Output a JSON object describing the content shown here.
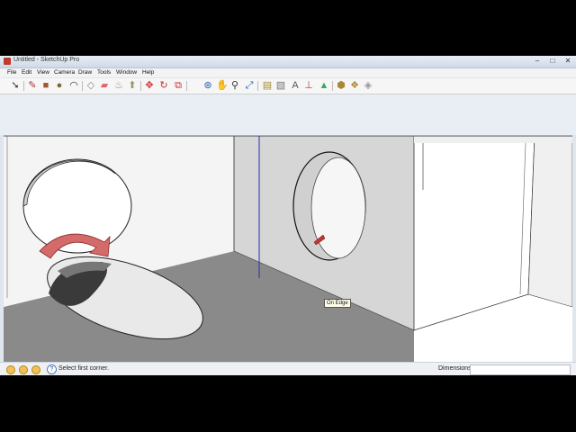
{
  "window": {
    "title": "Untitled - SketchUp Pro"
  },
  "menu": [
    "File",
    "Edit",
    "View",
    "Camera",
    "Draw",
    "Tools",
    "Window",
    "Help"
  ],
  "window_buttons": {
    "minimize": "–",
    "maximize": "□",
    "close": "✕"
  },
  "toolbar_icons": [
    "select-tool-icon",
    "line-tool-icon",
    "rectangle-tool-icon",
    "circle-tool-icon",
    "arc-tool-icon",
    "make-component-icon",
    "eraser-tool-icon",
    "paint-bucket-icon",
    "push-pull-tool-icon",
    "move-tool-icon",
    "rotate-tool-icon",
    "offset-tool-icon",
    "orbit-tool-icon",
    "pan-tool-icon",
    "zoom-tool-icon",
    "zoom-extents-icon",
    "tape-measure-icon",
    "section-plane-icon",
    "text-tool-icon",
    "axes-tool-icon",
    "3d-warehouse-icon",
    "share-model-icon",
    "component-library-icon",
    "extension-icon",
    "layout-send-icon",
    "help-icon"
  ],
  "viewport": {
    "tooltip": "On Edge"
  },
  "status": {
    "prompt": "Select first corner.",
    "measure_label": "Dimensions",
    "measure_value": ""
  },
  "colors": {
    "accent": "#1e4f8a",
    "rotate_arrow": "#c94f4f",
    "axis_blue": "#2233aa"
  }
}
